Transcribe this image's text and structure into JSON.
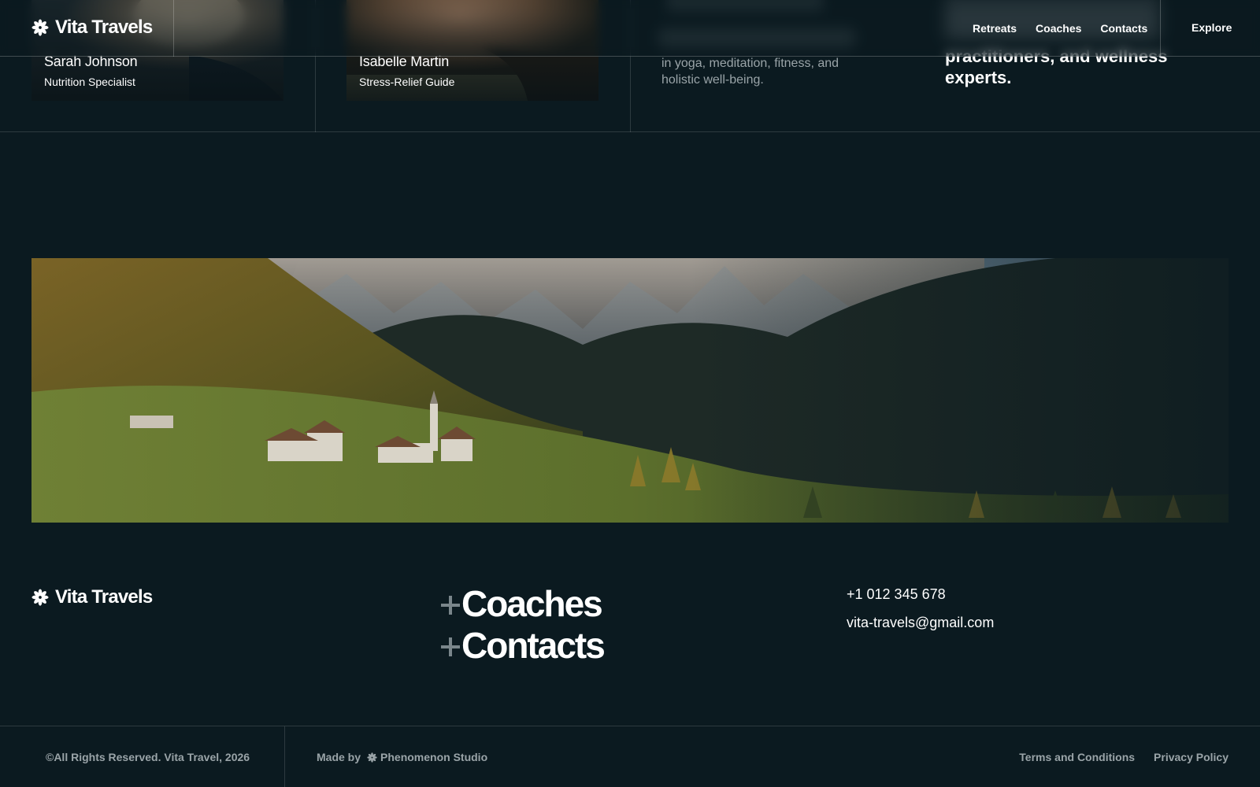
{
  "header": {
    "logo_text": "Vita Travels",
    "nav": [
      "Retreats",
      "Coaches",
      "Contacts"
    ],
    "explore_label": "Explore"
  },
  "coaches": [
    {
      "name": "Sarah Johnson",
      "role": "Nutrition Specialist"
    },
    {
      "name": "Isabelle Martin",
      "role": "Stress-Relief Guide"
    }
  ],
  "intro": {
    "text": "in yoga, meditation, fitness, and holistic well-being."
  },
  "tagline": {
    "text": "practitioners, and wellness experts."
  },
  "footer": {
    "logo_text": "Vita Travels",
    "links": [
      "Coaches",
      "Contacts"
    ],
    "phone": "+1 012 345 678",
    "email": "vita-travels@gmail.com"
  },
  "bottom": {
    "copyright": "©All Rights Reserved. Vita Travel, 2026",
    "made_by_label": "Made by",
    "studio": "Phenomenon Studio",
    "terms": "Terms and Conditions",
    "privacy": "Privacy Policy"
  },
  "colors": {
    "background": "#0b1a20",
    "muted_text": "#9aa4a8",
    "plus_accent": "#7a868b"
  }
}
